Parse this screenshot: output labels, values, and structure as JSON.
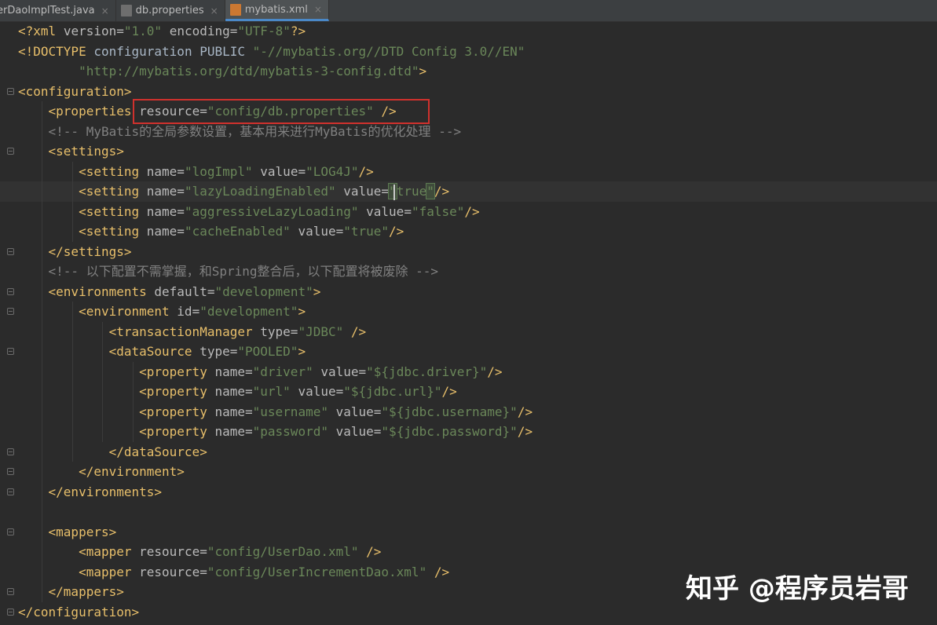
{
  "tabs": [
    {
      "label": "erDaoImplTest.java",
      "close": "×"
    },
    {
      "label": "db.properties",
      "close": "×"
    },
    {
      "label": "mybatis.xml",
      "close": "×",
      "active": true
    }
  ],
  "code_lines": [
    "<?xml version=\"1.0\" encoding=\"UTF-8\"?>",
    "<!DOCTYPE configuration PUBLIC \"-//mybatis.org//DTD Config 3.0//EN\"",
    "        \"http://mybatis.org/dtd/mybatis-3-config.dtd\">",
    "<configuration>",
    "    <properties resource=\"config/db.properties\" />",
    "    <!-- MyBatis的全局参数设置，基本用来进行MyBatis的优化处理 -->",
    "    <settings>",
    "        <setting name=\"logImpl\" value=\"LOG4J\"/>",
    "        <setting name=\"lazyLoadingEnabled\" value=\"true\"/>",
    "        <setting name=\"aggressiveLazyLoading\" value=\"false\"/>",
    "        <setting name=\"cacheEnabled\" value=\"true\"/>",
    "    </settings>",
    "    <!-- 以下配置不需掌握，和Spring整合后，以下配置将被废除 -->",
    "    <environments default=\"development\">",
    "        <environment id=\"development\">",
    "            <transactionManager type=\"JDBC\" />",
    "            <dataSource type=\"POOLED\">",
    "                <property name=\"driver\" value=\"${jdbc.driver}\"/>",
    "                <property name=\"url\" value=\"${jdbc.url}\"/>",
    "                <property name=\"username\" value=\"${jdbc.username}\"/>",
    "                <property name=\"password\" value=\"${jdbc.password}\"/>",
    "            </dataSource>",
    "        </environment>",
    "    </environments>",
    "",
    "    <mappers>",
    "        <mapper resource=\"config/UserDao.xml\" />",
    "        <mapper resource=\"config/UserIncrementDao.xml\" />",
    "    </mappers>",
    "</configuration>"
  ],
  "editor": {
    "current_line": 9,
    "highlighted_line": 5,
    "highlighted_text": "resource=\"config/db.properties\" />"
  },
  "watermark": "知乎 @程序员岩哥",
  "colors": {
    "background": "#2b2b2b",
    "tag": "#e8bf6a",
    "attribute": "#bababa",
    "value": "#6a8759",
    "comment": "#808080",
    "highlight_box": "#d0312d"
  }
}
